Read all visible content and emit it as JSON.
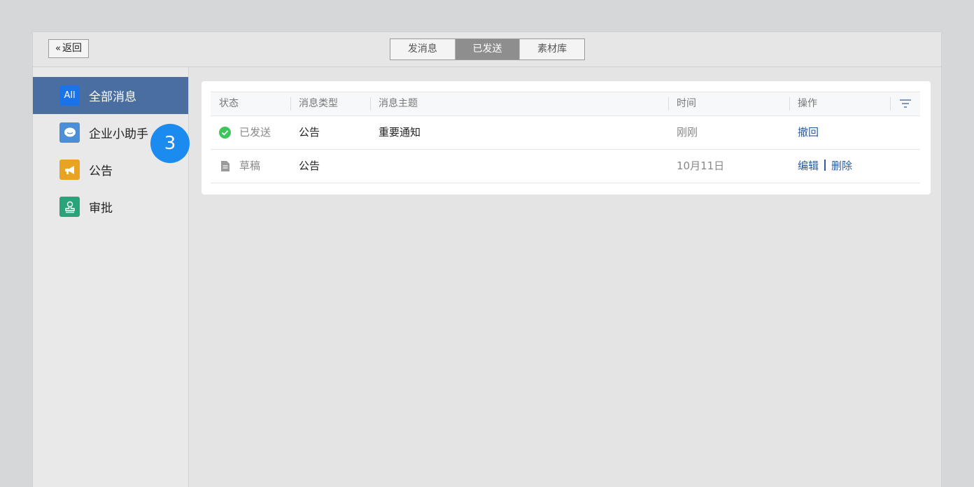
{
  "topbar": {
    "back_label": "返回",
    "tabs": [
      {
        "label": "发消息",
        "active": false
      },
      {
        "label": "已发送",
        "active": true
      },
      {
        "label": "素材库",
        "active": false
      }
    ]
  },
  "sidebar": {
    "items": [
      {
        "label": "全部消息",
        "icon_text": "All",
        "icon": "all-icon",
        "color": "#1a73e8",
        "active": true
      },
      {
        "label": "企业小助手",
        "icon": "chat-bubble-icon",
        "color": "#4a8fd8",
        "active": false
      },
      {
        "label": "公告",
        "icon": "megaphone-icon",
        "color": "#e8a322",
        "active": false
      },
      {
        "label": "审批",
        "icon": "stamp-icon",
        "color": "#2aa37a",
        "active": false
      }
    ],
    "badge": "3"
  },
  "table": {
    "headers": [
      "状态",
      "消息类型",
      "消息主题",
      "时间",
      "操作"
    ],
    "rows": [
      {
        "status": "已发送",
        "status_icon": "check-circle-icon",
        "type": "公告",
        "subject": "重要通知",
        "time": "刚刚",
        "actions": [
          "撤回"
        ]
      },
      {
        "status": "草稿",
        "status_icon": "document-icon",
        "type": "公告",
        "subject": "",
        "time": "10月11日",
        "actions": [
          "编辑",
          "删除"
        ]
      }
    ]
  },
  "colors": {
    "accent": "#4b6ea0",
    "link": "#2a5b9c",
    "badge": "#1b8bf0",
    "success": "#3cc55a"
  }
}
